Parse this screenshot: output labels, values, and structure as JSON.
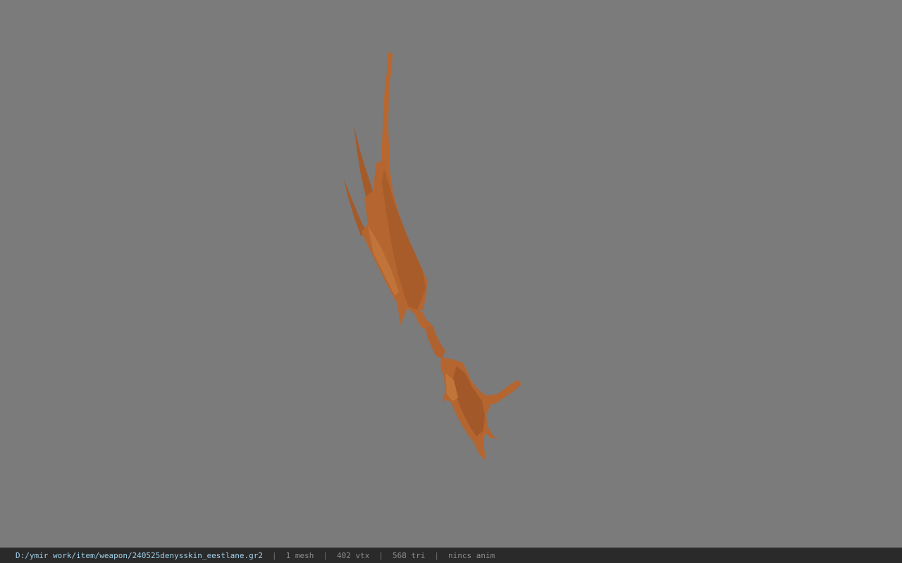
{
  "viewer": {
    "background_color": "#7b7b7b",
    "model_color": "#b5652f",
    "model_name": "weapon-mesh"
  },
  "statusbar": {
    "file_path": "D:/ymir work/item/weapon/240525denysskin_eestlane.gr2",
    "separator": "|",
    "mesh_count": "1 mesh",
    "vertex_count": "402 vtx",
    "triangle_count": "568 tri",
    "animation": "nincs anim"
  }
}
